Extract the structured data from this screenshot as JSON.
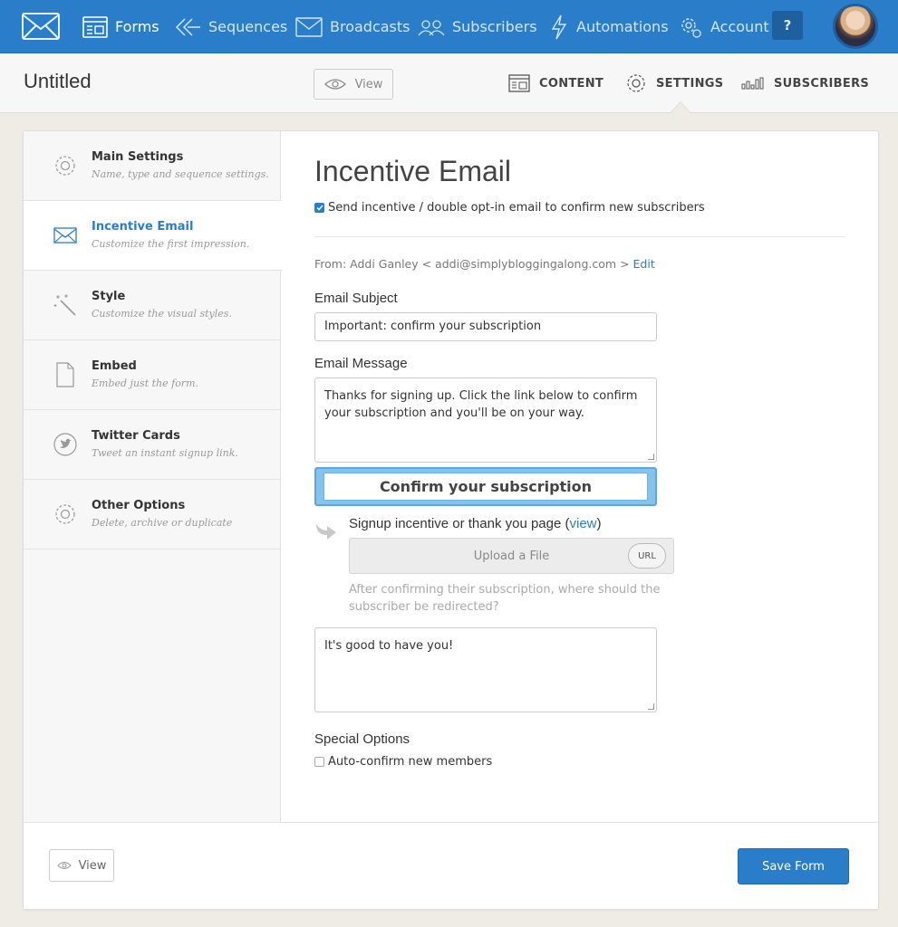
{
  "nav": {
    "items": [
      {
        "label": "Forms",
        "icon": "forms-icon"
      },
      {
        "label": "Sequences",
        "icon": "sequences-icon"
      },
      {
        "label": "Broadcasts",
        "icon": "broadcasts-icon"
      },
      {
        "label": "Subscribers",
        "icon": "subscribers-icon"
      },
      {
        "label": "Automations",
        "icon": "automations-icon"
      },
      {
        "label": "Account",
        "icon": "account-gear-icon"
      }
    ],
    "help_label": "?"
  },
  "header": {
    "title": "Untitled",
    "view_label": "View",
    "tabs": [
      {
        "label": "CONTENT"
      },
      {
        "label": "SETTINGS"
      },
      {
        "label": "SUBSCRIBERS"
      }
    ]
  },
  "sidebar": {
    "items": [
      {
        "title": "Main Settings",
        "subtitle": "Name, type and sequence settings."
      },
      {
        "title": "Incentive Email",
        "subtitle": "Customize the first impression."
      },
      {
        "title": "Style",
        "subtitle": "Customize the visual styles."
      },
      {
        "title": "Embed",
        "subtitle": "Embed just the form."
      },
      {
        "title": "Twitter Cards",
        "subtitle": "Tweet an instant signup link."
      },
      {
        "title": "Other Options",
        "subtitle": "Delete, archive or duplicate"
      }
    ]
  },
  "main": {
    "heading": "Incentive Email",
    "send_checkbox_label": "Send incentive / double opt-in email to confirm new subscribers",
    "from_text": "From: Addi Ganley < addi@simplybloggingalong.com > ",
    "edit_label": "Edit",
    "subject_label": "Email Subject",
    "subject_value": "Important: confirm your subscription",
    "message_label": "Email Message",
    "message_value": "Thanks for signing up. Click the link below to confirm your subscription and you'll be on your way.",
    "confirm_button_label": "Confirm your subscription",
    "incentive_label": "Signup incentive or thank you page (",
    "incentive_view_link": "view",
    "incentive_label_close": ")",
    "upload_label": "Upload a File",
    "url_label": "URL",
    "redirect_help": "After confirming their subscription, where should the subscriber be redirected?",
    "thanks_value": "It's good to have you!",
    "special_label": "Special Options",
    "autoconfirm_label": "Auto-confirm new members"
  },
  "footer": {
    "view_label": "View",
    "save_label": "Save Form"
  },
  "colors": {
    "nav_blue": "#2a7ec9",
    "link_blue": "#2a7ec9",
    "page_bg": "#efece6"
  }
}
